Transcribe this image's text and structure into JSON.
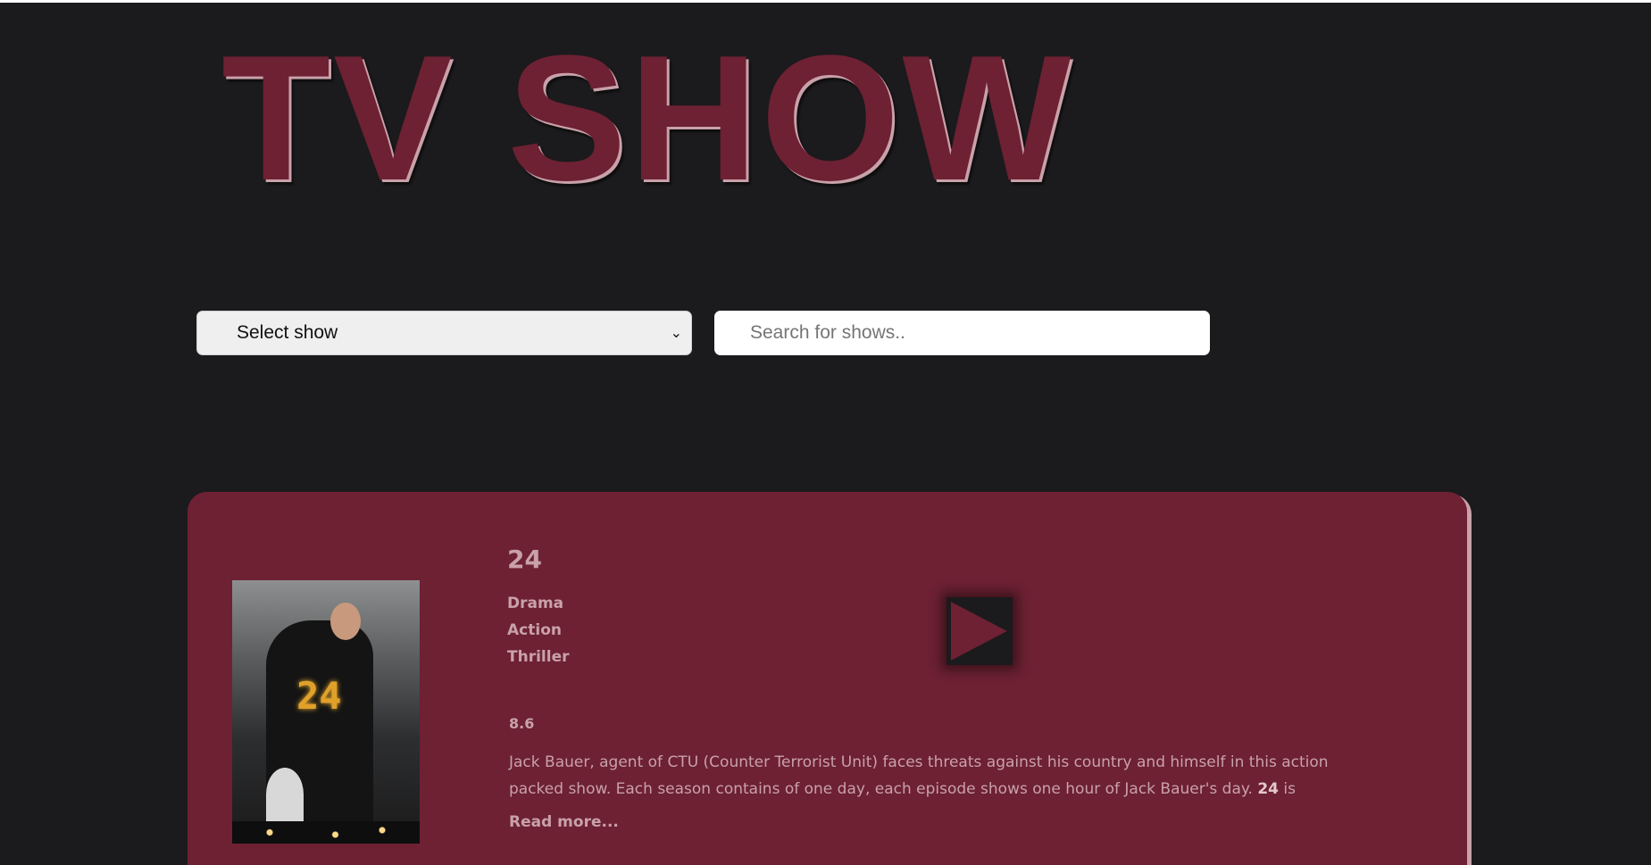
{
  "header": {
    "title": "TV SHOW"
  },
  "controls": {
    "select_label": "Select show",
    "search_placeholder": "Search for shows.."
  },
  "colors": {
    "background": "#1b1a1c",
    "accent": "#6d2133",
    "text_muted": "#c9a1a9"
  },
  "show": {
    "name": "24",
    "genres": [
      "Drama",
      "Action",
      "Thriller"
    ],
    "rating": "8.6",
    "summary_text": "Jack Bauer, agent of CTU (Counter Terrorist Unit) faces threats against his country and himself in this action packed show. Each season contains of one day, each episode shows one hour of Jack Bauer's day.",
    "summary_bold": "24",
    "summary_tail": "is",
    "read_more": "Read more...",
    "poster_icon": "tv-poster-image",
    "play_icon": "play-icon"
  }
}
